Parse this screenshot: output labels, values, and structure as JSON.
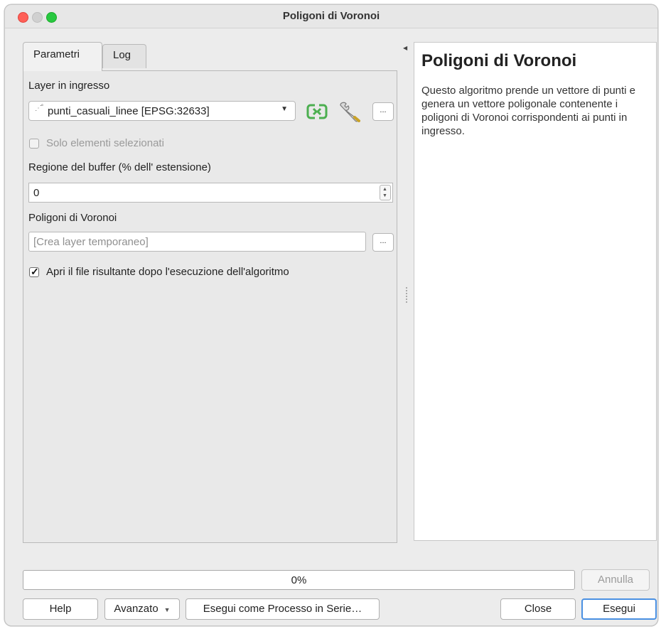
{
  "window": {
    "title": "Poligoni di Voronoi"
  },
  "tabs": [
    {
      "label": "Parametri",
      "active": true
    },
    {
      "label": "Log",
      "active": false
    }
  ],
  "params": {
    "input_layer_label": "Layer in ingresso",
    "input_layer_value": "punti_casuali_linee [EPSG:32633]",
    "selected_only_label": "Solo elementi selezionati",
    "selected_only_checked": false,
    "buffer_label": "Regione del buffer (% dell' estensione)",
    "buffer_value": "0",
    "output_label": "Poligoni di Voronoi",
    "output_placeholder": "[Crea layer temporaneo]",
    "open_after_label": "Apri il file risultante dopo l'esecuzione dell'algoritmo",
    "open_after_checked": true,
    "browse_label": "...",
    "icons": {
      "iterate": "iterate-icon",
      "settings": "wrench-icon",
      "layer_type": "point-layer-icon"
    }
  },
  "help": {
    "title": "Poligoni di Voronoi",
    "text": "Questo algoritmo prende un vettore di punti e genera un vettore poligonale contenente i poligoni di Voronoi corrispondenti ai punti in ingresso."
  },
  "progress": {
    "value": 0,
    "label": "0%"
  },
  "buttons": {
    "cancel": "Annulla",
    "help": "Help",
    "advanced": "Avanzato",
    "batch": "Esegui come Processo in Serie…",
    "close": "Close",
    "run": "Esegui"
  },
  "colors": {
    "accent": "#4a90e2",
    "iterate_green": "#4caf50"
  }
}
